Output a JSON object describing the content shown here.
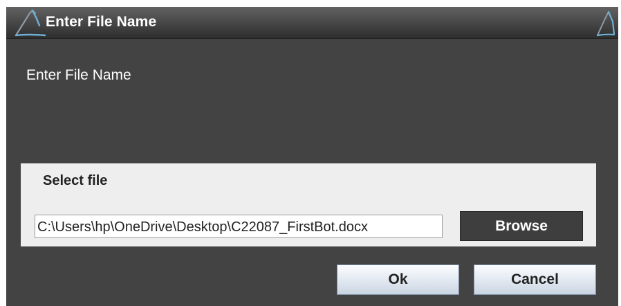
{
  "window": {
    "title": "Enter File Name",
    "logo_icon": "app-logo-icon",
    "colors": {
      "background": "#434343",
      "titlebar_top": "#626262",
      "titlebar_bottom": "#2e2e2e",
      "logo_accent": "#6fb0d8",
      "panel": "#eeeeee",
      "browse_button": "#3e3e3e"
    }
  },
  "dialog": {
    "message": "Enter File Name",
    "file_panel": {
      "title": "Select file",
      "path_value": "C:\\Users\\hp\\OneDrive\\Desktop\\C22087_FirstBot.docx",
      "browse_label": "Browse"
    },
    "ok_label": "Ok",
    "cancel_label": "Cancel"
  }
}
